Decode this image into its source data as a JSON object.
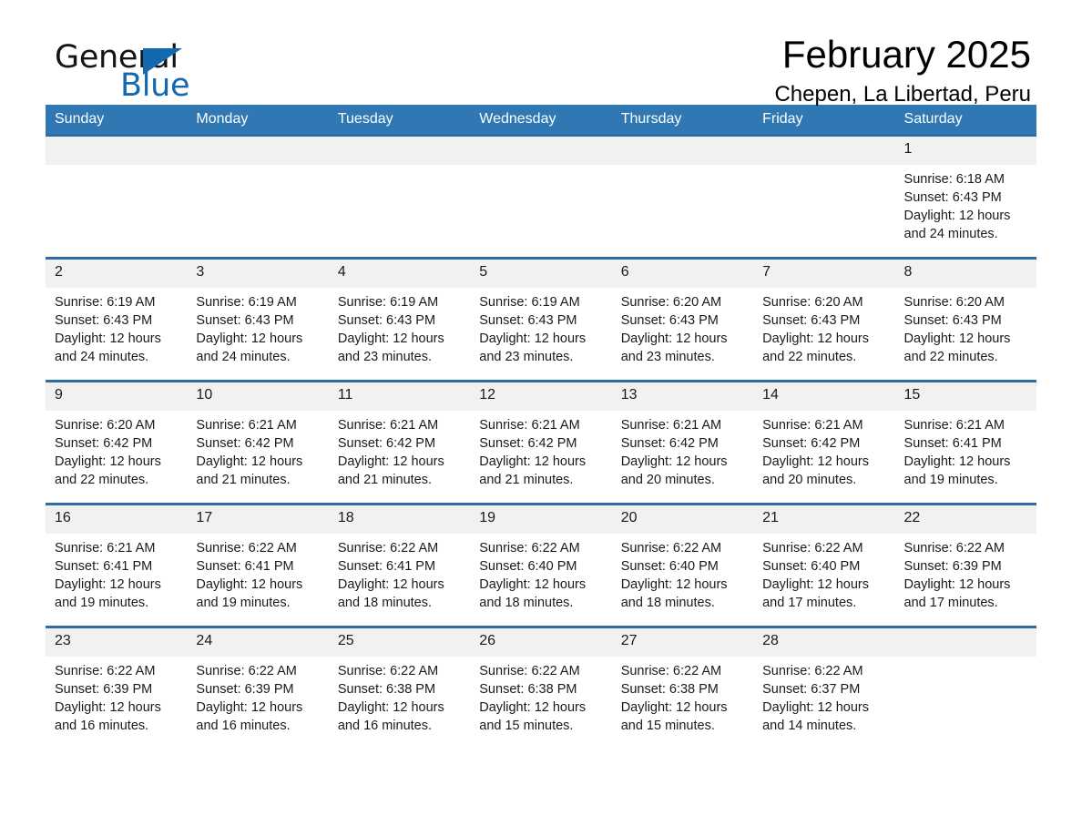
{
  "brand": {
    "name_part1": "General",
    "name_part2": "Blue",
    "triangle_color": "#1269b0"
  },
  "header": {
    "month_title": "February 2025",
    "location": "Chepen, La Libertad, Peru"
  },
  "theme": {
    "header_blue": "#3078b4",
    "row_border_blue": "#2e6da4",
    "daynum_bg": "#f1f1f1"
  },
  "weekdays": [
    "Sunday",
    "Monday",
    "Tuesday",
    "Wednesday",
    "Thursday",
    "Friday",
    "Saturday"
  ],
  "weeks": [
    [
      {
        "day": "",
        "blank": true
      },
      {
        "day": "",
        "blank": true
      },
      {
        "day": "",
        "blank": true
      },
      {
        "day": "",
        "blank": true
      },
      {
        "day": "",
        "blank": true
      },
      {
        "day": "",
        "blank": true
      },
      {
        "day": "1",
        "sunrise": "Sunrise: 6:18 AM",
        "sunset": "Sunset: 6:43 PM",
        "daylight_line1": "Daylight: 12 hours",
        "daylight_line2": "and 24 minutes."
      }
    ],
    [
      {
        "day": "2",
        "sunrise": "Sunrise: 6:19 AM",
        "sunset": "Sunset: 6:43 PM",
        "daylight_line1": "Daylight: 12 hours",
        "daylight_line2": "and 24 minutes."
      },
      {
        "day": "3",
        "sunrise": "Sunrise: 6:19 AM",
        "sunset": "Sunset: 6:43 PM",
        "daylight_line1": "Daylight: 12 hours",
        "daylight_line2": "and 24 minutes."
      },
      {
        "day": "4",
        "sunrise": "Sunrise: 6:19 AM",
        "sunset": "Sunset: 6:43 PM",
        "daylight_line1": "Daylight: 12 hours",
        "daylight_line2": "and 23 minutes."
      },
      {
        "day": "5",
        "sunrise": "Sunrise: 6:19 AM",
        "sunset": "Sunset: 6:43 PM",
        "daylight_line1": "Daylight: 12 hours",
        "daylight_line2": "and 23 minutes."
      },
      {
        "day": "6",
        "sunrise": "Sunrise: 6:20 AM",
        "sunset": "Sunset: 6:43 PM",
        "daylight_line1": "Daylight: 12 hours",
        "daylight_line2": "and 23 minutes."
      },
      {
        "day": "7",
        "sunrise": "Sunrise: 6:20 AM",
        "sunset": "Sunset: 6:43 PM",
        "daylight_line1": "Daylight: 12 hours",
        "daylight_line2": "and 22 minutes."
      },
      {
        "day": "8",
        "sunrise": "Sunrise: 6:20 AM",
        "sunset": "Sunset: 6:43 PM",
        "daylight_line1": "Daylight: 12 hours",
        "daylight_line2": "and 22 minutes."
      }
    ],
    [
      {
        "day": "9",
        "sunrise": "Sunrise: 6:20 AM",
        "sunset": "Sunset: 6:42 PM",
        "daylight_line1": "Daylight: 12 hours",
        "daylight_line2": "and 22 minutes."
      },
      {
        "day": "10",
        "sunrise": "Sunrise: 6:21 AM",
        "sunset": "Sunset: 6:42 PM",
        "daylight_line1": "Daylight: 12 hours",
        "daylight_line2": "and 21 minutes."
      },
      {
        "day": "11",
        "sunrise": "Sunrise: 6:21 AM",
        "sunset": "Sunset: 6:42 PM",
        "daylight_line1": "Daylight: 12 hours",
        "daylight_line2": "and 21 minutes."
      },
      {
        "day": "12",
        "sunrise": "Sunrise: 6:21 AM",
        "sunset": "Sunset: 6:42 PM",
        "daylight_line1": "Daylight: 12 hours",
        "daylight_line2": "and 21 minutes."
      },
      {
        "day": "13",
        "sunrise": "Sunrise: 6:21 AM",
        "sunset": "Sunset: 6:42 PM",
        "daylight_line1": "Daylight: 12 hours",
        "daylight_line2": "and 20 minutes."
      },
      {
        "day": "14",
        "sunrise": "Sunrise: 6:21 AM",
        "sunset": "Sunset: 6:42 PM",
        "daylight_line1": "Daylight: 12 hours",
        "daylight_line2": "and 20 minutes."
      },
      {
        "day": "15",
        "sunrise": "Sunrise: 6:21 AM",
        "sunset": "Sunset: 6:41 PM",
        "daylight_line1": "Daylight: 12 hours",
        "daylight_line2": "and 19 minutes."
      }
    ],
    [
      {
        "day": "16",
        "sunrise": "Sunrise: 6:21 AM",
        "sunset": "Sunset: 6:41 PM",
        "daylight_line1": "Daylight: 12 hours",
        "daylight_line2": "and 19 minutes."
      },
      {
        "day": "17",
        "sunrise": "Sunrise: 6:22 AM",
        "sunset": "Sunset: 6:41 PM",
        "daylight_line1": "Daylight: 12 hours",
        "daylight_line2": "and 19 minutes."
      },
      {
        "day": "18",
        "sunrise": "Sunrise: 6:22 AM",
        "sunset": "Sunset: 6:41 PM",
        "daylight_line1": "Daylight: 12 hours",
        "daylight_line2": "and 18 minutes."
      },
      {
        "day": "19",
        "sunrise": "Sunrise: 6:22 AM",
        "sunset": "Sunset: 6:40 PM",
        "daylight_line1": "Daylight: 12 hours",
        "daylight_line2": "and 18 minutes."
      },
      {
        "day": "20",
        "sunrise": "Sunrise: 6:22 AM",
        "sunset": "Sunset: 6:40 PM",
        "daylight_line1": "Daylight: 12 hours",
        "daylight_line2": "and 18 minutes."
      },
      {
        "day": "21",
        "sunrise": "Sunrise: 6:22 AM",
        "sunset": "Sunset: 6:40 PM",
        "daylight_line1": "Daylight: 12 hours",
        "daylight_line2": "and 17 minutes."
      },
      {
        "day": "22",
        "sunrise": "Sunrise: 6:22 AM",
        "sunset": "Sunset: 6:39 PM",
        "daylight_line1": "Daylight: 12 hours",
        "daylight_line2": "and 17 minutes."
      }
    ],
    [
      {
        "day": "23",
        "sunrise": "Sunrise: 6:22 AM",
        "sunset": "Sunset: 6:39 PM",
        "daylight_line1": "Daylight: 12 hours",
        "daylight_line2": "and 16 minutes."
      },
      {
        "day": "24",
        "sunrise": "Sunrise: 6:22 AM",
        "sunset": "Sunset: 6:39 PM",
        "daylight_line1": "Daylight: 12 hours",
        "daylight_line2": "and 16 minutes."
      },
      {
        "day": "25",
        "sunrise": "Sunrise: 6:22 AM",
        "sunset": "Sunset: 6:38 PM",
        "daylight_line1": "Daylight: 12 hours",
        "daylight_line2": "and 16 minutes."
      },
      {
        "day": "26",
        "sunrise": "Sunrise: 6:22 AM",
        "sunset": "Sunset: 6:38 PM",
        "daylight_line1": "Daylight: 12 hours",
        "daylight_line2": "and 15 minutes."
      },
      {
        "day": "27",
        "sunrise": "Sunrise: 6:22 AM",
        "sunset": "Sunset: 6:38 PM",
        "daylight_line1": "Daylight: 12 hours",
        "daylight_line2": "and 15 minutes."
      },
      {
        "day": "28",
        "sunrise": "Sunrise: 6:22 AM",
        "sunset": "Sunset: 6:37 PM",
        "daylight_line1": "Daylight: 12 hours",
        "daylight_line2": "and 14 minutes."
      },
      {
        "day": "",
        "blank": true
      }
    ]
  ]
}
